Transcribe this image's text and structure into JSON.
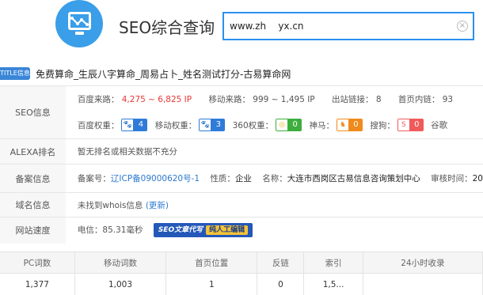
{
  "header": {
    "brand_title": "SEO综合查询",
    "search_value": "www.zh    yx.cn",
    "logo_icon": "monitor-chart-icon"
  },
  "site_title": {
    "badge": "TITLE信息",
    "text": "免费算命_生辰八字算命_周易占卜_姓名测试打分-古易算命网"
  },
  "seo": {
    "label": "SEO信息",
    "baidu_traffic_label": "百度来路：",
    "baidu_traffic_value": "4,275 ~ 6,825 IP",
    "mobile_traffic_label": "移动来路：",
    "mobile_traffic_value": "999 ~ 1,495 IP",
    "outlinks_label": "出站链接：",
    "outlinks_value": "8",
    "inlinks_label": "首页内链：",
    "inlinks_value": "93",
    "baidu_weight_label": "百度权重：",
    "baidu_weight": "4",
    "mobile_weight_label": "移动权重：",
    "mobile_weight": "3",
    "w360_label": "360权重：",
    "w360": "0",
    "shenma_label": "神马：",
    "shenma": "0",
    "sogou_label": "搜狗：",
    "sogou": "0",
    "google_label": "谷歌"
  },
  "alexa": {
    "label": "ALEXA排名",
    "value": "暂无排名或相关数据不充分"
  },
  "icp": {
    "label": "备案信息",
    "num_label": "备案号：",
    "num_value": "辽ICP备09000620号-1",
    "nature_label": "性质：",
    "nature_value": "企业",
    "name_label": "名称：",
    "name_value": "大连市西岗区古易信息咨询策划中心",
    "date_label": "审核时间：",
    "date_value": "20"
  },
  "whois": {
    "label": "域名信息",
    "value": "未找到whois信息",
    "update_link": "(更新)"
  },
  "speed": {
    "label": "网站速度",
    "value": "电信：85.31毫秒",
    "ad_text": "SEO文章代写",
    "ad_tag": "纯人工编辑"
  },
  "stats": {
    "headers": [
      "PC词数",
      "移动词数",
      "首页位置",
      "反链",
      "索引",
      "24小时收录"
    ],
    "values": [
      "1,377",
      "1,003",
      "1",
      "0",
      "1,5...",
      ""
    ]
  },
  "colors": {
    "accent": "#2b8ff0",
    "red": "#e83535",
    "baidu": "#2f7bd9",
    "mobile": "#2f7bd9",
    "w360": "#3dae3d",
    "shenma": "#f08a1c",
    "sogou": "#f05a5a"
  }
}
